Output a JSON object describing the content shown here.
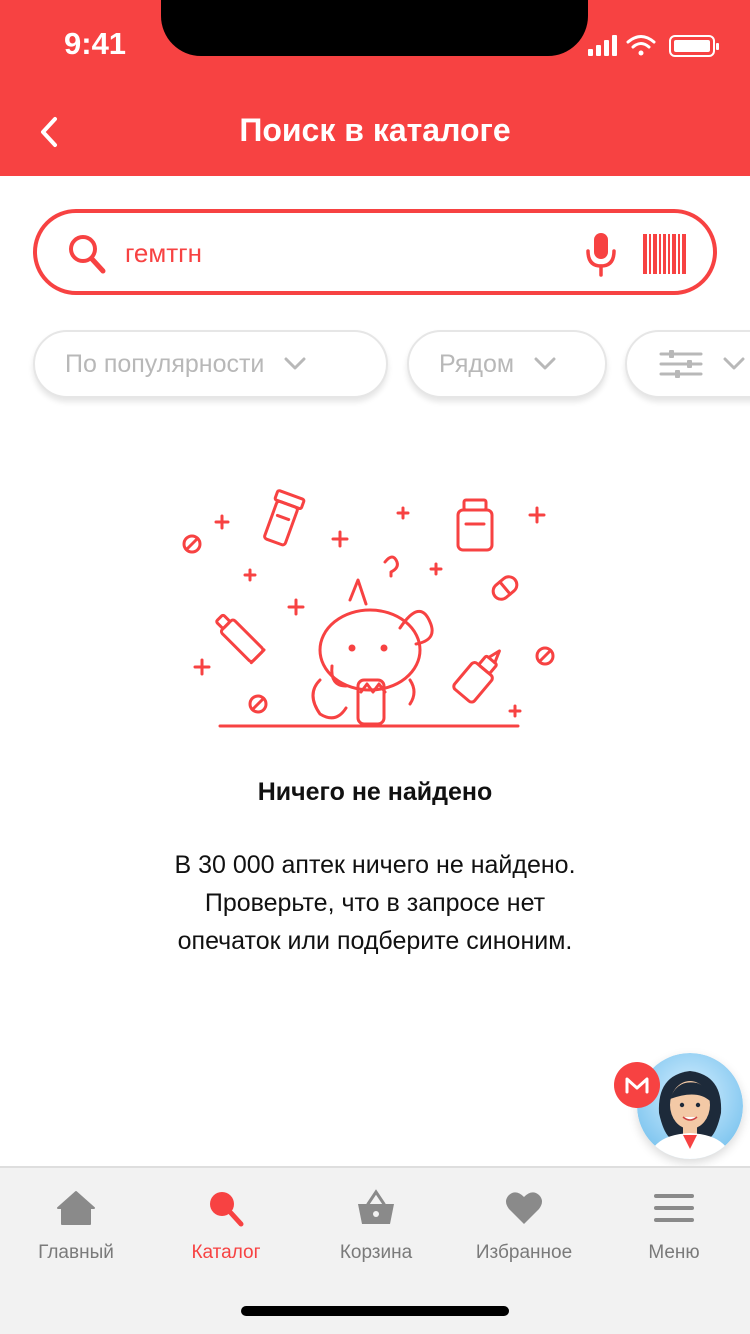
{
  "status_bar": {
    "time": "9:41"
  },
  "header": {
    "title": "Поиск в каталоге"
  },
  "search": {
    "value": "гемтгн"
  },
  "filters": [
    {
      "label": "По популярности"
    },
    {
      "label": "Рядом"
    }
  ],
  "empty_state": {
    "title": "Ничего не найдено",
    "lines": [
      "В 30 000 аптек ничего не найдено.",
      "Проверьте, что в запросе нет",
      "опечаток или подберите синоним."
    ]
  },
  "tabbar": {
    "items": [
      {
        "label": "Главный",
        "icon": "home-icon",
        "active": false
      },
      {
        "label": "Каталог",
        "icon": "search-icon",
        "active": true
      },
      {
        "label": "Корзина",
        "icon": "basket-icon",
        "active": false
      },
      {
        "label": "Избранное",
        "icon": "heart-icon",
        "active": false
      },
      {
        "label": "Меню",
        "icon": "menu-icon",
        "active": false
      }
    ]
  },
  "colors": {
    "accent": "#f74242",
    "inactive": "#7a7a7a",
    "chip_text": "#b8b8b8"
  }
}
